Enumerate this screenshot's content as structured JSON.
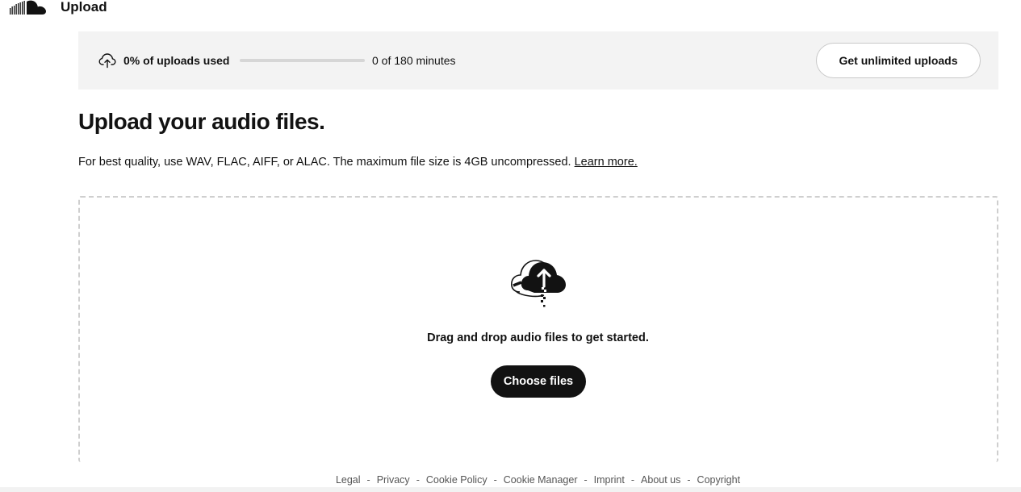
{
  "header": {
    "logo_icon": "soundcloud-logo-icon",
    "title": "Upload"
  },
  "usage": {
    "icon": "cloud-upload-icon",
    "label": "0% of uploads used",
    "progress_fraction": 0,
    "minutes": "0 of 180 minutes",
    "upgrade_label": "Get unlimited uploads"
  },
  "main": {
    "title": "Upload your audio files.",
    "description": "For best quality, use WAV, FLAC, AIFF, or ALAC. The maximum file size is 4GB uncompressed.",
    "learn_more": "Learn more."
  },
  "dropzone": {
    "illustration_icon": "cloud-upload-arrow-icon",
    "prompt": "Drag and drop audio files to get started.",
    "choose_label": "Choose files"
  },
  "footer": {
    "links": [
      "Legal",
      "Privacy",
      "Cookie Policy",
      "Cookie Manager",
      "Imprint",
      "About us",
      "Copyright"
    ],
    "separator": "-"
  },
  "colors": {
    "text": "#121212",
    "banner_bg": "#f3f3f3",
    "primary_button": "#121212",
    "dashed_border": "#cfcfcf"
  }
}
